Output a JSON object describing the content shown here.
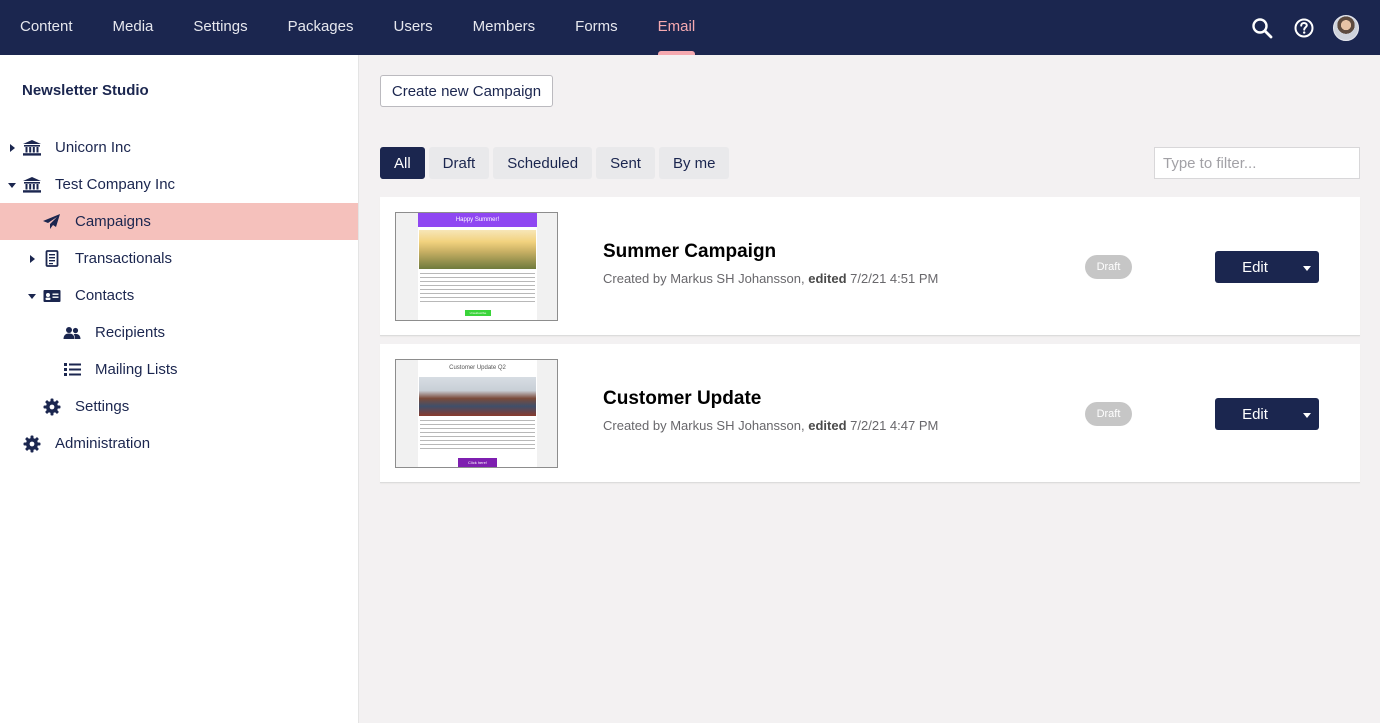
{
  "topnav": {
    "items": [
      {
        "label": "Content",
        "active": false
      },
      {
        "label": "Media",
        "active": false
      },
      {
        "label": "Settings",
        "active": false
      },
      {
        "label": "Packages",
        "active": false
      },
      {
        "label": "Users",
        "active": false
      },
      {
        "label": "Members",
        "active": false
      },
      {
        "label": "Forms",
        "active": false
      },
      {
        "label": "Email",
        "active": true
      }
    ],
    "icons": [
      "search-icon",
      "help-icon",
      "avatar"
    ]
  },
  "sidebar": {
    "title": "Newsletter Studio",
    "items": [
      {
        "label": "Unicorn Inc",
        "icon": "institution-icon"
      },
      {
        "label": "Test Company Inc",
        "icon": "institution-icon"
      },
      {
        "label": "Campaigns",
        "icon": "paper-plane-icon",
        "selected": true
      },
      {
        "label": "Transactionals",
        "icon": "receipt-icon"
      },
      {
        "label": "Contacts",
        "icon": "contact-card-icon"
      },
      {
        "label": "Recipients",
        "icon": "users-icon"
      },
      {
        "label": "Mailing Lists",
        "icon": "list-icon"
      },
      {
        "label": "Settings",
        "icon": "gear-icon"
      },
      {
        "label": "Administration",
        "icon": "gear-icon"
      }
    ]
  },
  "main": {
    "create_label": "Create new Campaign",
    "tabs": [
      {
        "label": "All",
        "active": true
      },
      {
        "label": "Draft",
        "active": false
      },
      {
        "label": "Scheduled",
        "active": false
      },
      {
        "label": "Sent",
        "active": false
      },
      {
        "label": "By me",
        "active": false
      }
    ],
    "filter_placeholder": "Type to filter...",
    "campaigns": [
      {
        "name": "Summer Campaign",
        "created_prefix": "Created by Markus SH Johansson,",
        "edited_label": "edited",
        "edited_at": "7/2/21 4:51 PM",
        "status": "Draft",
        "edit_label": "Edit",
        "thumb_title": "Happy Summer!",
        "thumb_button": "Unsubscribe"
      },
      {
        "name": "Customer Update",
        "created_prefix": "Created by Markus SH Johansson,",
        "edited_label": "edited",
        "edited_at": "7/2/21 4:47 PM",
        "status": "Draft",
        "edit_label": "Edit",
        "thumb_title": "Customer Update Q2",
        "thumb_button": "Click here!"
      }
    ]
  },
  "colors": {
    "brand_navy": "#1b264f",
    "accent_pink": "#f5a9b0",
    "selected_bg": "#f5c1bc",
    "badge_gray": "#c6c6c6",
    "thumb_purple": "#8f47f2",
    "thumb_green": "#3ad43a",
    "thumb_button_purple": "#7e1fb0"
  }
}
